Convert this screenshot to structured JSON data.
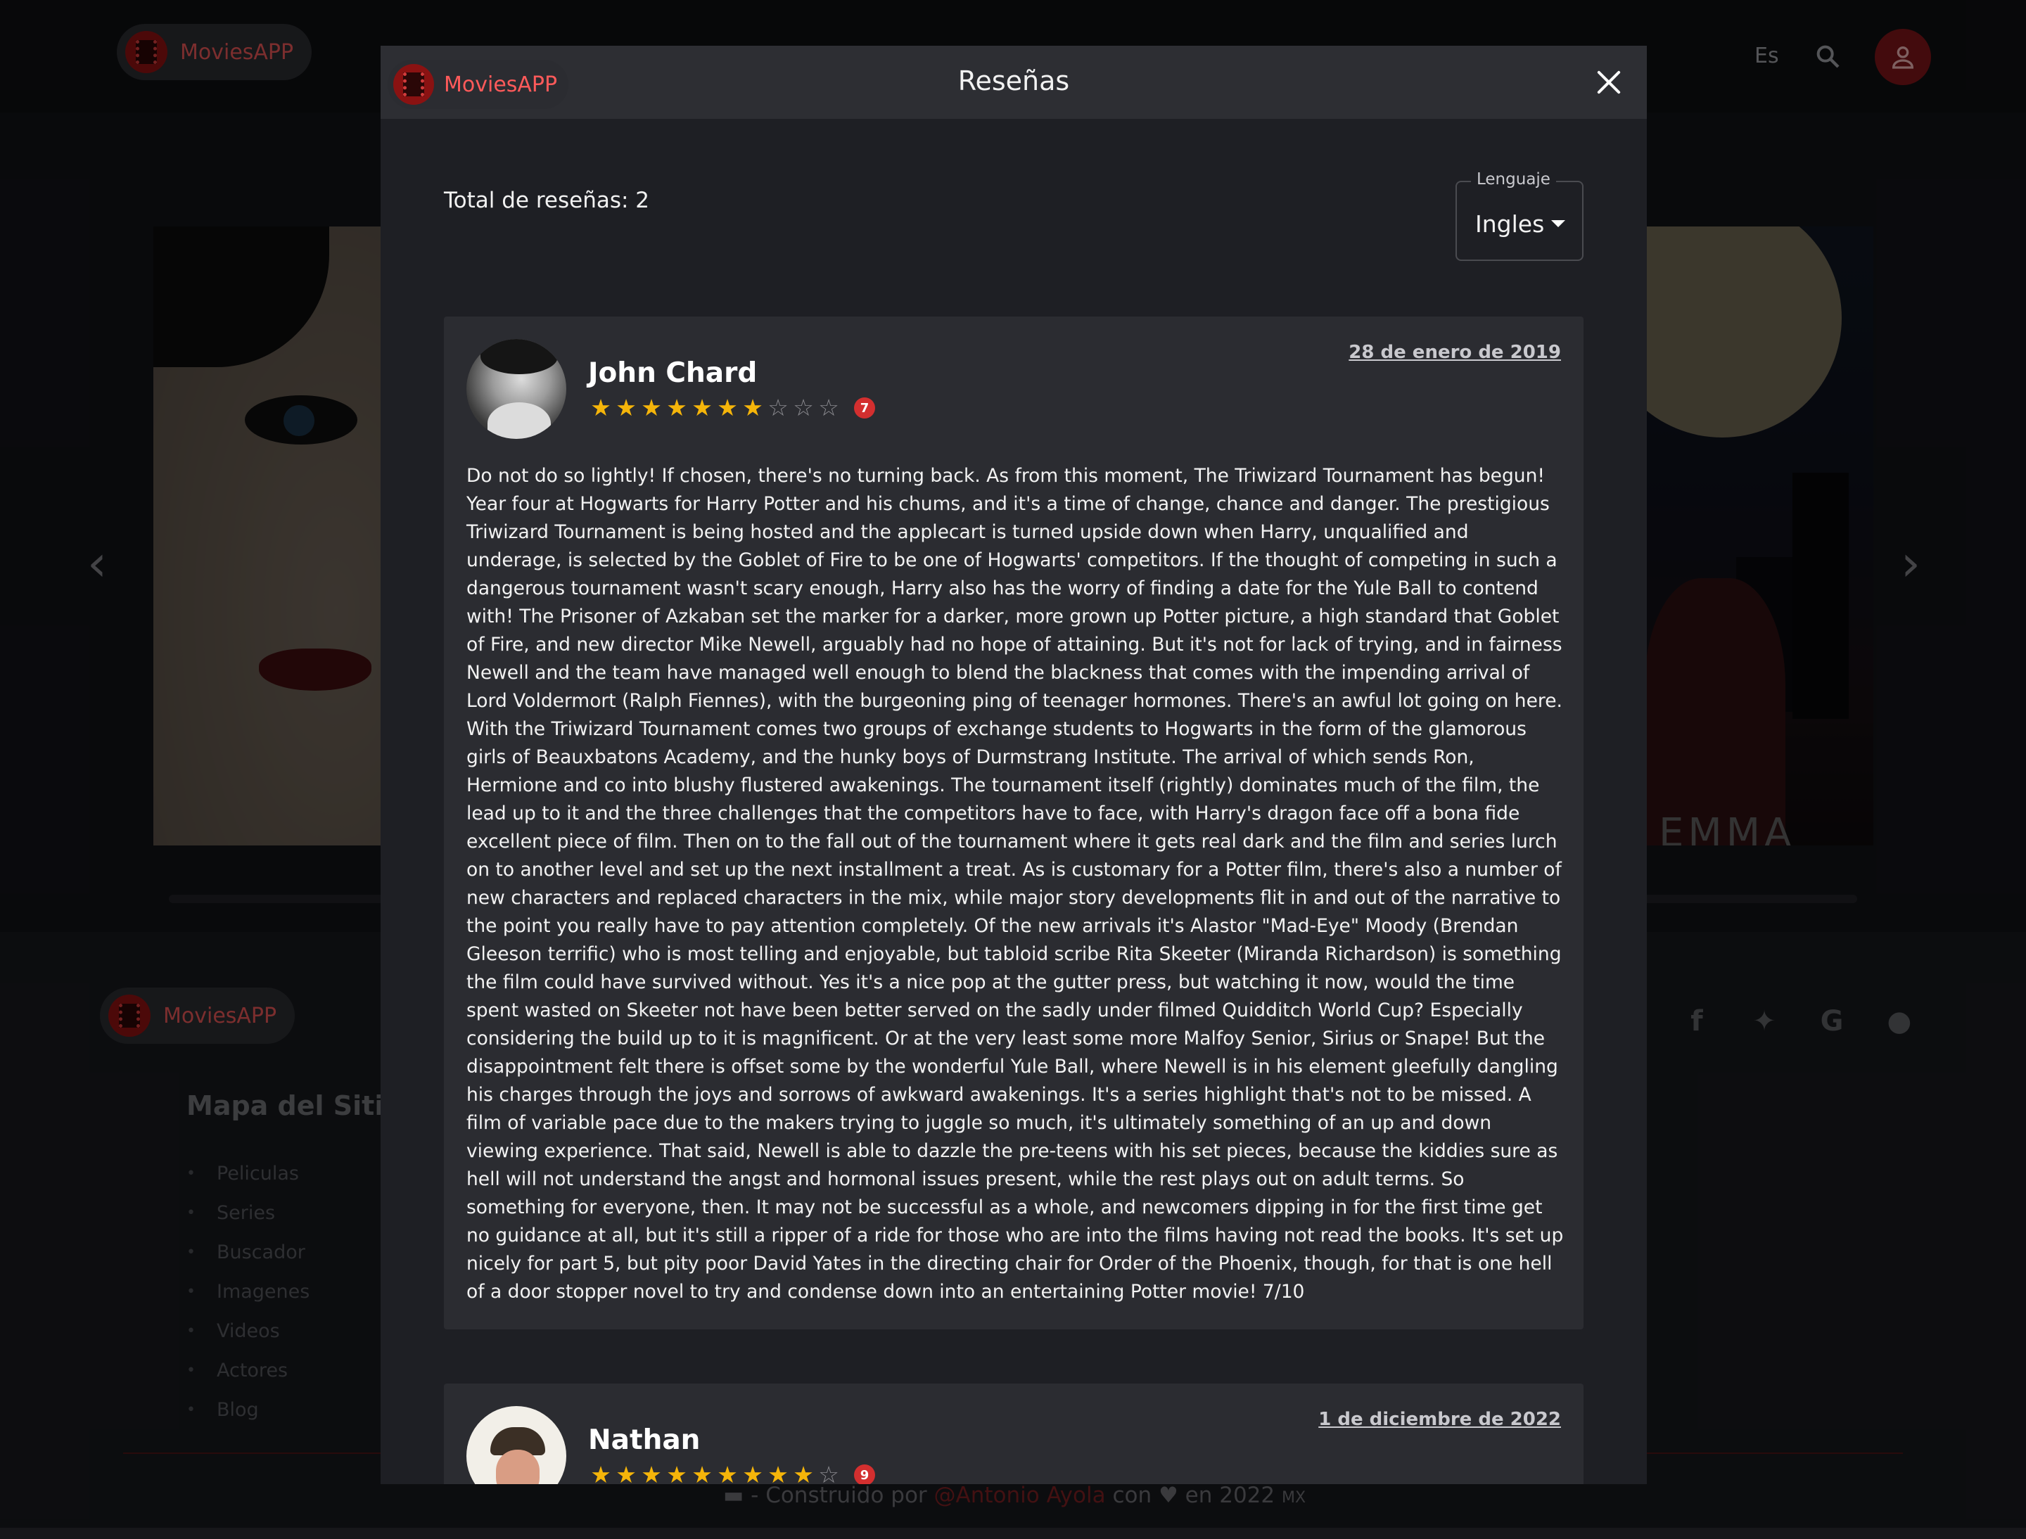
{
  "app": {
    "brand": "MoviesAPP"
  },
  "header": {
    "language": "Es"
  },
  "background": {
    "poster_right_word": "EMMA",
    "footer": {
      "brand": "MoviesAPP",
      "sitemap_title": "Mapa del Sitio",
      "links": [
        "Peliculas",
        "Series",
        "Buscador",
        "Imagenes",
        "Videos",
        "Actores",
        "Blog"
      ],
      "social": [
        "facebook-icon",
        "twitter-icon",
        "google-icon",
        "github-icon"
      ],
      "credit_prefix": "- Construido por",
      "credit_author": "@Antonio Ayola",
      "credit_with": "con",
      "credit_year": "en 2022",
      "credit_country": "MX"
    }
  },
  "modal": {
    "brand": "MoviesAPP",
    "title": "Reseñas",
    "total_reviews": "Total de reseñas: 2",
    "language_label": "Lenguaje",
    "language_value": "Ingles",
    "reviews": [
      {
        "author": "John Chard",
        "rating": 7,
        "max_rating": 10,
        "badge": "7",
        "date": "28 de enero de 2019",
        "content": "Do not do so lightly! If chosen, there's no turning back. As from this moment, The Triwizard Tournament has begun! Year four at Hogwarts for Harry Potter and his chums, and it's a time of change, chance and danger. The prestigious Triwizard Tournament is being hosted and the applecart is turned upside down when Harry, unqualified and underage, is selected by the Goblet of Fire to be one of Hogwarts' competitors. If the thought of competing in such a dangerous tournament wasn't scary enough, Harry also has the worry of finding a date for the Yule Ball to contend with! The Prisoner of Azkaban set the marker for a darker, more grown up Potter picture, a high standard that Goblet of Fire, and new director Mike Newell, arguably had no hope of attaining. But it's not for lack of trying, and in fairness Newell and the team have managed well enough to blend the blackness that comes with the impending arrival of Lord Voldermort (Ralph Fiennes), with the burgeoning ping of teenager hormones. There's an awful lot going on here. With the Triwizard Tournament comes two groups of exchange students to Hogwarts in the form of the glamorous girls of Beauxbatons Academy, and the hunky boys of Durmstrang Institute. The arrival of which sends Ron, Hermione and co into blushy flustered awakenings. The tournament itself (rightly) dominates much of the film, the lead up to it and the three challenges that the competitors have to face, with Harry's dragon face off a bona fide excellent piece of film. Then on to the fall out of the tournament where it gets real dark and the film and series lurch on to another level and set up the next installment a treat. As is customary for a Potter film, there's also a number of new characters and replaced characters in the mix, while major story developments flit in and out of the narrative to the point you really have to pay attention completely. Of the new arrivals it's Alastor \"Mad-Eye\" Moody (Brendan Gleeson terrific) who is most telling and enjoyable, but tabloid scribe Rita Skeeter (Miranda Richardson) is something the film could have survived without. Yes it's a nice pop at the gutter press, but watching it now, would the time spent wasted on Skeeter not have been better served on the sadly under filmed Quidditch World Cup? Especially considering the build up to it is magnificent. Or at the very least some more Malfoy Senior, Sirius or Snape! But the disappointment felt there is offset some by the wonderful Yule Ball, where Newell is in his element gleefully dangling his charges through the joys and sorrows of awkward awakenings. It's a series highlight that's not to be missed. A film of variable pace due to the makers trying to juggle so much, it's ultimately something of an up and down viewing experience. That said, Newell is able to dazzle the pre-teens with his set pieces, because the kiddies sure as hell will not understand the angst and hormonal issues present, while the rest plays out on adult terms. So something for everyone, then. It may not be successful as a whole, and newcomers dipping in for the first time get no guidance at all, but it's still a ripper of a ride for those who are into the films having not read the books. It's set up nicely for part 5, but pity poor David Yates in the directing chair for Order of the Phoenix, though, for that is one hell of a door stopper novel to try and condense down into an entertaining Potter movie! 7/10"
      },
      {
        "author": "Nathan",
        "rating": 9,
        "max_rating": 10,
        "badge": "9",
        "date": "1 de diciembre de 2022",
        "content": ""
      }
    ]
  }
}
